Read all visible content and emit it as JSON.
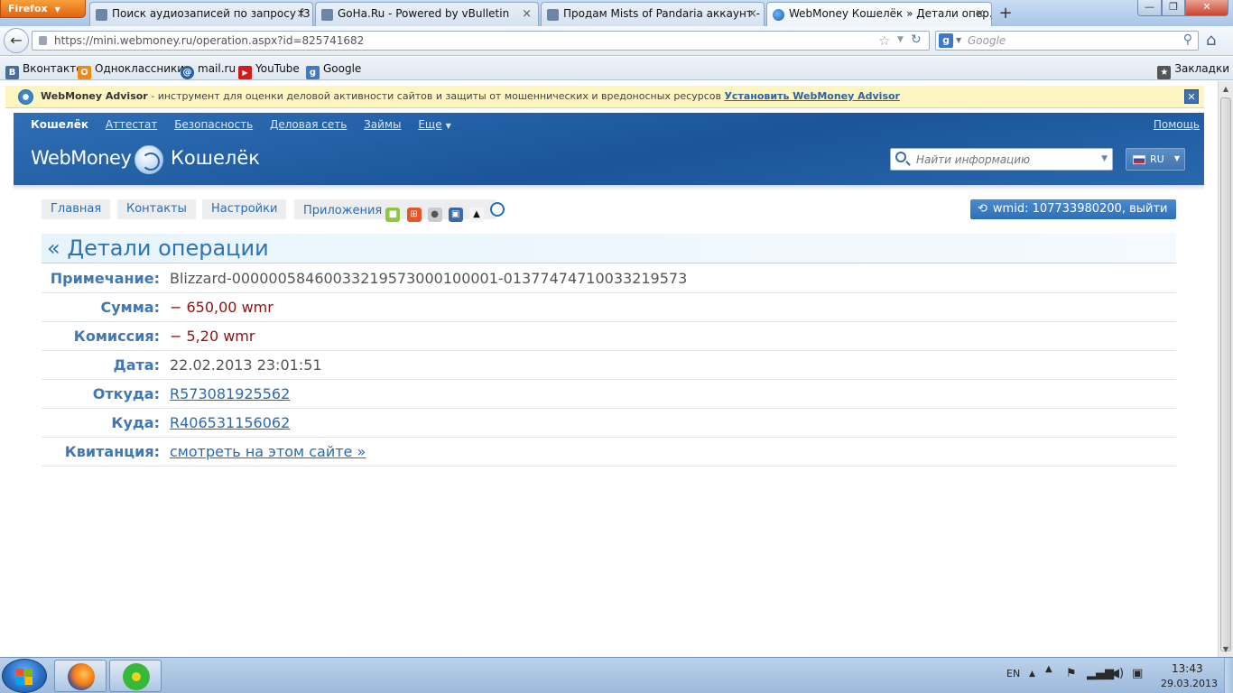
{
  "browser": {
    "menu_button": "Firefox",
    "tabs": [
      {
        "title": "Поиск аудиозаписей по запросу f3 |..."
      },
      {
        "title": "GoHa.Ru - Powered by vBulletin"
      },
      {
        "title": "Продам Mists of Pandaria аккаунт - ..."
      },
      {
        "title": "WebMoney Кошелёк » Детали опер...",
        "active": true
      }
    ],
    "url": "https://mini.webmoney.ru/operation.aspx?id=825741682",
    "search_placeholder": "Google",
    "bookmarks": [
      {
        "label": "Вконтакте",
        "icon": "vk-icon",
        "glyph": "В"
      },
      {
        "label": "Одноклассники",
        "icon": "odnoklassniki-icon",
        "glyph": "О"
      },
      {
        "label": "mail.ru",
        "icon": "mailru-icon",
        "glyph": "@"
      },
      {
        "label": "YouTube",
        "icon": "youtube-icon",
        "glyph": "▶"
      },
      {
        "label": "Google",
        "icon": "google-icon",
        "glyph": "g"
      }
    ],
    "bookmarks_menu": "Закладки"
  },
  "advisor_bar": {
    "brand": "WebMoney Advisor",
    "text": " - инструмент для оценки деловой активности сайтов и защиты от мошеннических и вредоносных ресурсов ",
    "link": "Установить WebMoney Advisor",
    "close": "✕"
  },
  "wm": {
    "top_nav": [
      {
        "label": "Кошелёк",
        "current": true
      },
      {
        "label": "Аттестат"
      },
      {
        "label": "Безопасность"
      },
      {
        "label": "Деловая сеть"
      },
      {
        "label": "Займы"
      },
      {
        "label": "Еще"
      }
    ],
    "help": "Помощь",
    "logo": "WebMoney",
    "logo_sub": "Кошелёк",
    "search_placeholder": "Найти информацию",
    "lang": "RU",
    "subnav": {
      "home": "Главная",
      "contacts": "Контакты",
      "settings": "Настройки",
      "apps": "Приложения"
    },
    "wmid": "wmid: 107733980200, выйти",
    "heading": "« Детали операции",
    "details": [
      {
        "label": "Примечание:",
        "value": "Blizzard-00000058460033219573000100001-01377474710033219573",
        "kind": "text"
      },
      {
        "label": "Сумма:",
        "value": "− 650,00 wmr",
        "kind": "neg"
      },
      {
        "label": "Комиссия:",
        "value": "− 5,20 wmr",
        "kind": "neg"
      },
      {
        "label": "Дата:",
        "value": "22.02.2013 23:01:51",
        "kind": "text"
      },
      {
        "label": "Откуда:",
        "value": "R573081925562",
        "kind": "link"
      },
      {
        "label": "Куда:",
        "value": "R406531156062",
        "kind": "link"
      },
      {
        "label": "Квитанция:",
        "value": "смотреть на этом сайте »",
        "kind": "link"
      }
    ]
  },
  "taskbar": {
    "lang": "EN",
    "time": "13:43",
    "date": "29.03.2013"
  },
  "colors": {
    "wm_header": "#1b5499",
    "label_blue": "#3f78b4",
    "negative": "#8f1212",
    "link": "#2a6ab3"
  }
}
